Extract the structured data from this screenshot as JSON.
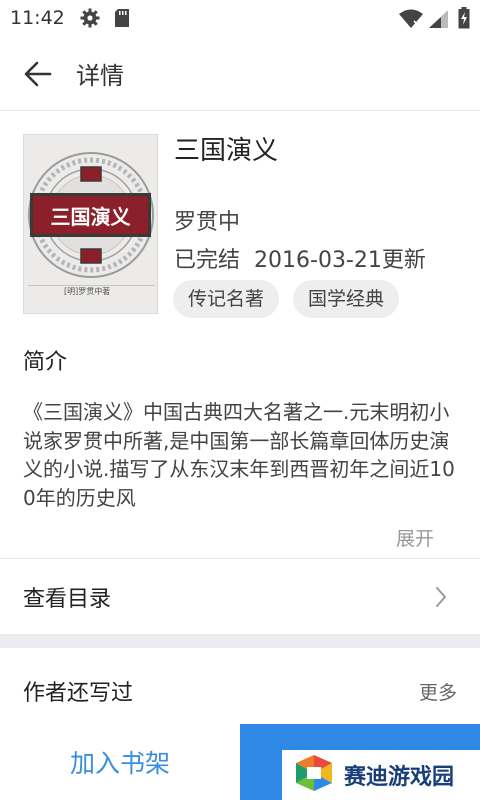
{
  "status_bar": {
    "time": "11:42",
    "icons": [
      "gear-icon",
      "sd-card-icon",
      "wifi-icon",
      "signal-icon",
      "battery-icon"
    ]
  },
  "toolbar": {
    "title": "详情",
    "back_icon": "arrow-left-icon"
  },
  "book": {
    "title": "三国演义",
    "author": "罗贯中",
    "status": "已完结",
    "updated": "2016-03-21更新",
    "tags": [
      "传记名著",
      "国学经典"
    ],
    "cover": {
      "title": "三国演义",
      "author_line": "[明]罗贯中著"
    }
  },
  "intro": {
    "heading": "简介",
    "text": "《三国演义》中国古典四大名著之一.元末明初小说家罗贯中所著,是中国第一部长篇章回体历史演义的小说.描写了从东汉末年到西晋初年之间近100年的历史风",
    "expand_label": "展开"
  },
  "catalog": {
    "label": "查看目录"
  },
  "author_works": {
    "label": "作者还写过",
    "more_label": "更多"
  },
  "actions": {
    "add_shelf_label": "加入书架"
  },
  "watermark": {
    "text": "赛迪游戏园"
  },
  "colors": {
    "accent": "#2f88e6",
    "link": "#3a8ee0",
    "cover_plaque": "#8b1f2a",
    "section_gap": "#ecebef",
    "tag_bg": "#eeeeee"
  }
}
